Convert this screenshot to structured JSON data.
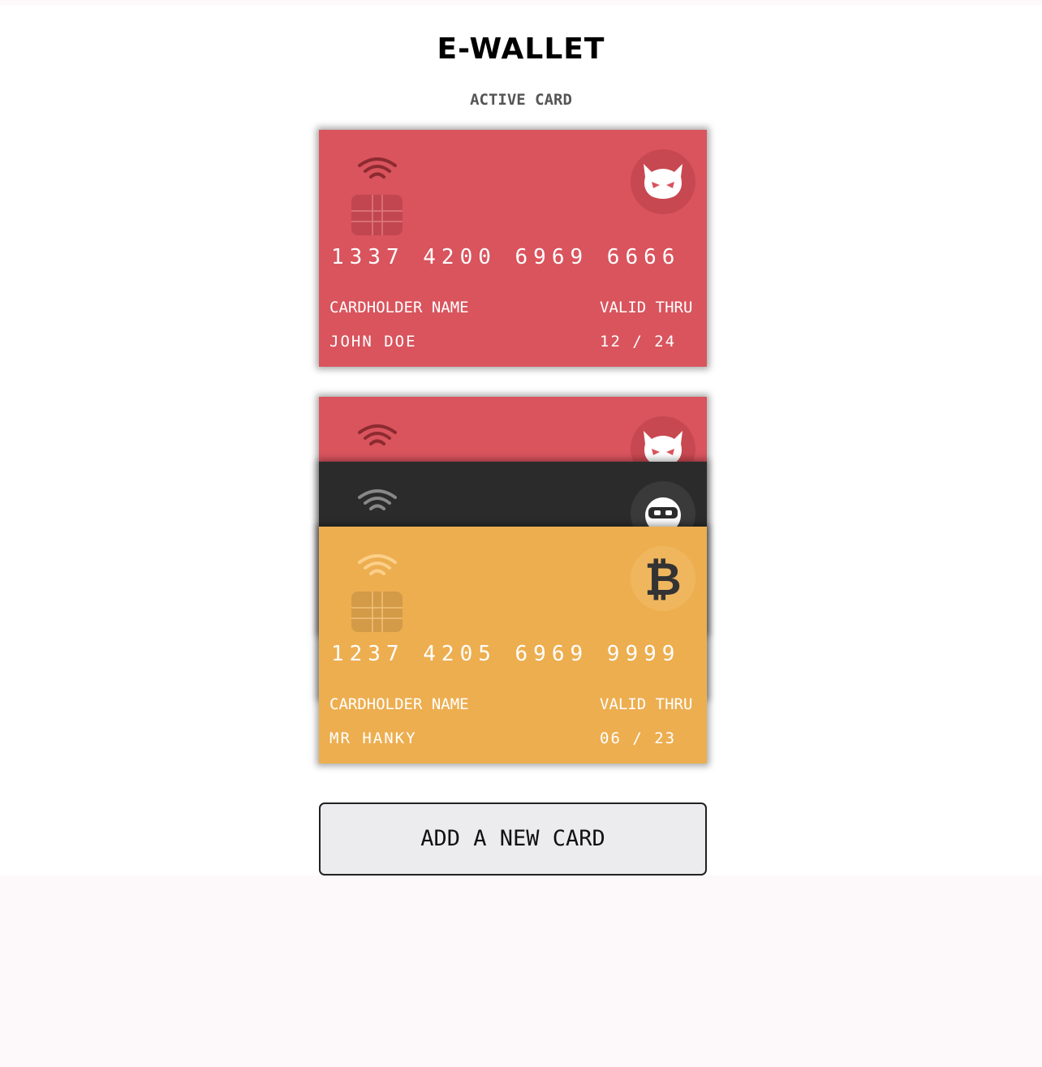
{
  "app": {
    "title": "E-WALLET",
    "subtitle": "ACTIVE CARD"
  },
  "colors": {
    "red_card": "#d9545d",
    "dark_card": "#2b2b2b",
    "yellow_card": "#edae50",
    "button_bg": "#ececee"
  },
  "active_card": {
    "number": "1337 4200 6969 6666",
    "holder_label": "CARDHOLDER NAME",
    "valid_label": "VALID THRU",
    "holder": "JOHN DOE",
    "valid": "12 / 24",
    "vendor_icon": "devil-icon"
  },
  "stack": {
    "cards": [
      {
        "vendor_icon": "devil-icon"
      },
      {
        "vendor_icon": "ninja-icon"
      },
      {
        "number": "1237 4205 6969 9999",
        "holder_label": "CARDHOLDER NAME",
        "valid_label": "VALID THRU",
        "holder": "MR HANKY",
        "valid": "06 / 23",
        "vendor_icon": "bitcoin-icon"
      }
    ]
  },
  "actions": {
    "add_card_label": "ADD A NEW CARD"
  }
}
